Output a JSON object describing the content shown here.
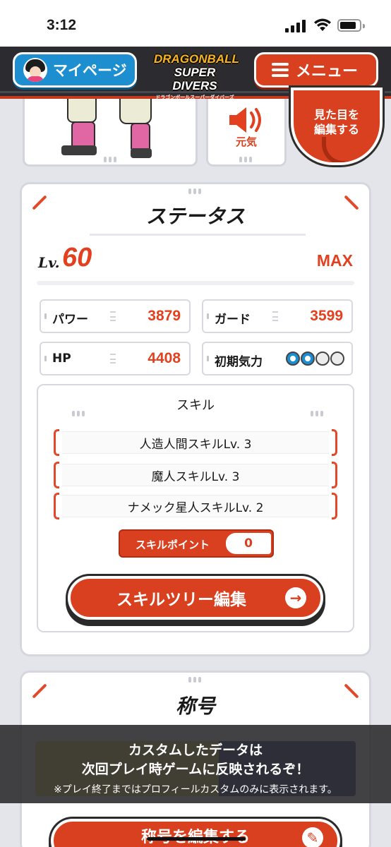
{
  "status_bar": {
    "time": "3:12"
  },
  "header": {
    "mypage_label": "マイページ",
    "logo_line1": "DRAGONBALL",
    "logo_line2": "SUPER DIVERS",
    "logo_sub": "ドラゴンボールスーパーダイバーズ",
    "menu_label": "メニュー"
  },
  "character": {
    "sound_label": "元気",
    "look_button_label_1": "見た目を",
    "look_button_label_2": "編集する"
  },
  "status": {
    "title": "ステータス",
    "level_label": "Lv.",
    "level_value": "60",
    "level_max": "MAX",
    "stats": [
      {
        "name": "パワー",
        "value": "3879"
      },
      {
        "name": "ガード",
        "value": "3599"
      },
      {
        "name": "HP",
        "value": "4408"
      },
      {
        "name": "初期気力",
        "value": ""
      }
    ],
    "initial_ki": {
      "filled": 2,
      "total": 4
    },
    "skill": {
      "title": "スキル",
      "items": [
        "人造人間スキルLv. 3",
        "魔人スキルLv. 3",
        "ナメック星人スキルLv. 2"
      ],
      "point_label": "スキルポイント",
      "point_value": "0",
      "tree_button_label": "スキルツリー編集"
    }
  },
  "titles": {
    "title": "称号",
    "edit_button_label": "称号を編集する"
  },
  "notice": {
    "line1": "カスタムしたデータは",
    "line2": "次回プレイ時ゲームに反映されるぞ！",
    "line3": "※プレイ終了まではプロフィールカスタムのみに表示されます。"
  },
  "colors": {
    "accent": "#d9401f",
    "blue": "#1d8fd0",
    "header_bg": "#2b2b30"
  }
}
